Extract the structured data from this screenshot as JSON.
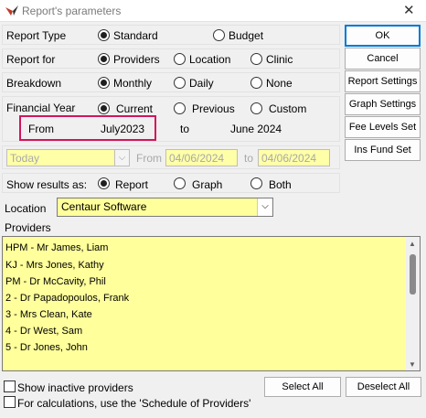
{
  "window": {
    "title": "Report's parameters"
  },
  "report_type": {
    "label": "Report Type",
    "options": [
      "Standard",
      "Budget"
    ],
    "selected": "Standard"
  },
  "report_for": {
    "label": "Report for",
    "options": [
      "Providers",
      "Location",
      "Clinic"
    ],
    "selected": "Providers"
  },
  "breakdown": {
    "label": "Breakdown",
    "options": [
      "Monthly",
      "Daily",
      "None"
    ],
    "selected": "Monthly"
  },
  "financial_year": {
    "label": "Financial Year",
    "options": [
      "Current",
      "Previous",
      "Custom"
    ],
    "selected": "Current",
    "from_label": "From",
    "from_value": "July2023",
    "to_label": "to",
    "to_value": "June 2024"
  },
  "date_range": {
    "preset": "Today",
    "from_label": "From",
    "from_value": "04/06/2024",
    "to_label": "to",
    "to_value": "04/06/2024"
  },
  "show_results": {
    "label": "Show results as:",
    "options": [
      "Report",
      "Graph",
      "Both"
    ],
    "selected": "Report"
  },
  "location": {
    "label": "Location",
    "value": "Centaur Software"
  },
  "providers": {
    "label": "Providers",
    "items": [
      "HPM - Mr James, Liam",
      "KJ - Mrs Jones, Kathy",
      "PM - Dr McCavity, Phil",
      "2 - Dr Papadopoulos, Frank",
      "3 - Mrs Clean, Kate",
      "4 - Dr West, Sam",
      "5 - Dr Jones, John"
    ]
  },
  "buttons": {
    "ok": "OK",
    "cancel": "Cancel",
    "report_settings": "Report Settings",
    "graph_settings": "Graph Settings",
    "fee_levels": "Fee Levels Set",
    "ins_fund": "Ins Fund Set",
    "select_all": "Select All",
    "deselect_all": "Deselect All"
  },
  "checks": {
    "inactive": "Show inactive providers",
    "schedule": "For calculations, use the 'Schedule of Providers'"
  },
  "colors": {
    "highlight": "#d0155c",
    "field": "#ffff9c",
    "accent": "#0078d7"
  }
}
